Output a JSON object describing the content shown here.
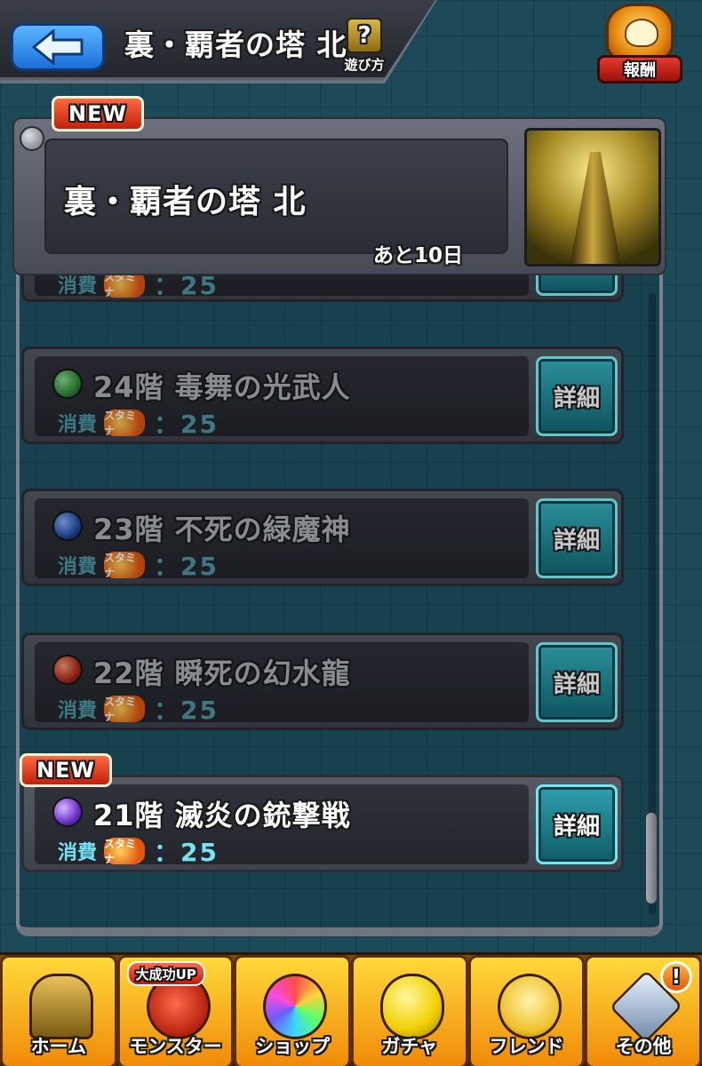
{
  "header": {
    "title": "裏・覇者の塔 北",
    "help_label": "遊び方",
    "help_icon": "?",
    "reward_label": "報酬"
  },
  "banner": {
    "badge": "NEW",
    "title": "裏・覇者の塔 北",
    "remaining": "あと10日"
  },
  "partial_row": {
    "cost_label": "消費",
    "stamina_icon_text": "スタミナ",
    "cost_value": "：25"
  },
  "stages": [
    {
      "name": "24階 毒舞の光武人",
      "cost_label": "消費",
      "stamina_icon_text": "スタミナ",
      "cost_value": "：25",
      "detail": "詳細",
      "orb_color": "#2e8b3a",
      "locked": true
    },
    {
      "name": "23階 不死の緑魔神",
      "cost_label": "消費",
      "stamina_icon_text": "スタミナ",
      "cost_value": "：25",
      "detail": "詳細",
      "orb_color": "#1f4fa8",
      "locked": true
    },
    {
      "name": "22階 瞬死の幻水龍",
      "cost_label": "消費",
      "stamina_icon_text": "スタミナ",
      "cost_value": "：25",
      "detail": "詳細",
      "orb_color": "#b02a1a",
      "locked": true
    },
    {
      "name": "21階 滅炎の銃撃戦",
      "cost_label": "消費",
      "stamina_icon_text": "スタミナ",
      "cost_value": "：25",
      "detail": "詳細",
      "orb_color": "#6b2fc9",
      "locked": false,
      "badge": "NEW"
    }
  ],
  "nav": [
    {
      "label": "ホーム",
      "icon": "home-gate-icon"
    },
    {
      "label": "モンスター",
      "icon": "monster-icon",
      "badge": "大成功UP"
    },
    {
      "label": "ショップ",
      "icon": "rainbow-orb-icon"
    },
    {
      "label": "ガチャ",
      "icon": "gacha-egg-icon"
    },
    {
      "label": "フレンド",
      "icon": "friends-icon"
    },
    {
      "label": "その他",
      "icon": "other-icon",
      "alert": "!"
    }
  ]
}
